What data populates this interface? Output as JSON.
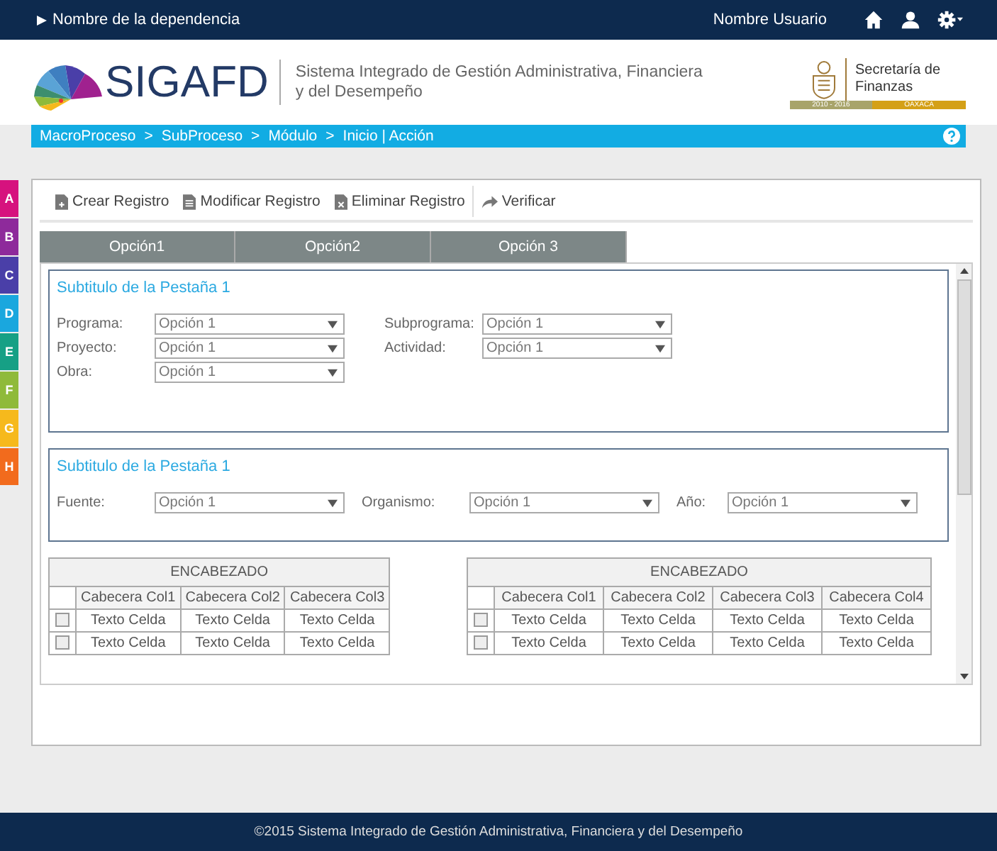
{
  "top_bar": {
    "dependency": "Nombre de la dependencia",
    "user": "Nombre Usuario"
  },
  "header": {
    "logo_text": "SIGAFD",
    "system_name": "Sistema Integrado de Gestión Administrativa, Financiera y del Desempeño",
    "secretaria": "Secretaría de Finanzas",
    "period": "2010 - 2016",
    "state": "OAXACA"
  },
  "breadcrumb": [
    "MacroProceso",
    ">",
    "SubProceso",
    ">",
    "Módulo",
    ">",
    "Inicio | Acción"
  ],
  "side_tabs": [
    {
      "label": "A",
      "color": "#d6127e"
    },
    {
      "label": "B",
      "color": "#8e2a9b"
    },
    {
      "label": "C",
      "color": "#4a3fa8"
    },
    {
      "label": "D",
      "color": "#1aa7de"
    },
    {
      "label": "E",
      "color": "#16a085"
    },
    {
      "label": "F",
      "color": "#8fba3a"
    },
    {
      "label": "G",
      "color": "#f6b91c"
    },
    {
      "label": "H",
      "color": "#f26b1d"
    }
  ],
  "toolbar": [
    {
      "label": "Crear Registro",
      "kind": "create"
    },
    {
      "label": "Modificar Registro",
      "kind": "edit"
    },
    {
      "label": "Eliminar Registro",
      "kind": "delete"
    },
    {
      "label": "Verificar",
      "kind": "verify"
    }
  ],
  "tabs": [
    "Opción1",
    "Opción2",
    "Opción 3"
  ],
  "sections": [
    {
      "title": "Subtitulo de la Pestaña 1",
      "kind": "two",
      "fields": [
        {
          "label": "Programa:",
          "value": "Opción 1"
        },
        {
          "label": "Subprograma:",
          "value": "Opción 1"
        },
        {
          "label": "Proyecto:",
          "value": "Opción 1"
        },
        {
          "label": "Actividad:",
          "value": "Opción 1"
        },
        {
          "label": "Obra:",
          "value": "Opción 1"
        }
      ]
    },
    {
      "title": "Subtitulo de la Pestaña 1",
      "kind": "three",
      "fields": [
        {
          "label": "Fuente:",
          "value": "Opción 1"
        },
        {
          "label": "Organismo:",
          "value": "Opción 1"
        },
        {
          "label": "Año:",
          "value": "Opción 1"
        }
      ]
    }
  ],
  "tables": [
    {
      "heading": "ENCABEZADO",
      "columns": [
        "Cabecera Col1",
        "Cabecera Col2",
        "Cabecera Col3"
      ],
      "rows": [
        {
          "checked": false,
          "cells": [
            "Texto Celda",
            "Texto Celda",
            "Texto Celda"
          ]
        },
        {
          "checked": false,
          "cells": [
            "Texto Celda",
            "Texto Celda",
            "Texto Celda"
          ]
        }
      ]
    },
    {
      "heading": "ENCABEZADO",
      "columns": [
        "Cabecera Col1",
        "Cabecera Col2",
        "Cabecera Col3",
        "Cabecera Col4"
      ],
      "rows": [
        {
          "checked": false,
          "cells": [
            "Texto Celda",
            "Texto Celda",
            "Texto Celda",
            "Texto Celda"
          ]
        },
        {
          "checked": false,
          "cells": [
            "Texto Celda",
            "Texto Celda",
            "Texto Celda",
            "Texto Celda"
          ]
        }
      ]
    }
  ],
  "footer": "©2015 Sistema Integrado de Gestión Administrativa, Financiera y del Desempeño"
}
